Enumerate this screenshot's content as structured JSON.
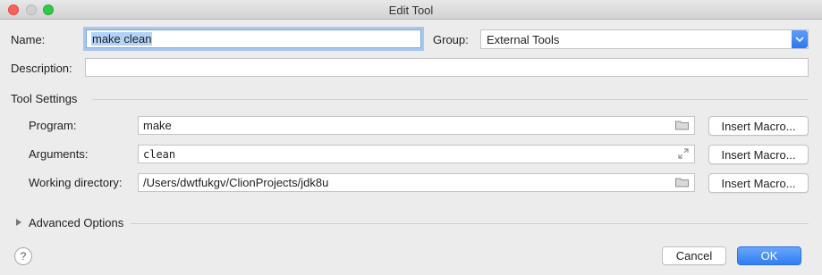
{
  "window": {
    "title": "Edit Tool"
  },
  "form": {
    "name_label": "Name:",
    "name_value": "make clean",
    "group_label": "Group:",
    "group_value": "External Tools",
    "description_label": "Description:",
    "description_value": ""
  },
  "tool_settings": {
    "header": "Tool Settings",
    "program_label": "Program:",
    "program_value": "make",
    "arguments_label": "Arguments:",
    "arguments_value": "clean",
    "workdir_label": "Working directory:",
    "workdir_value": "/Users/dwtfukgv/ClionProjects/jdk8u",
    "insert_macro_label": "Insert Macro..."
  },
  "advanced": {
    "label": "Advanced Options"
  },
  "footer": {
    "help_label": "?",
    "cancel_label": "Cancel",
    "ok_label": "OK"
  },
  "icons": {
    "folder": "folder-icon",
    "expand": "expand-icon",
    "dropdown": "chevron-down-icon"
  }
}
